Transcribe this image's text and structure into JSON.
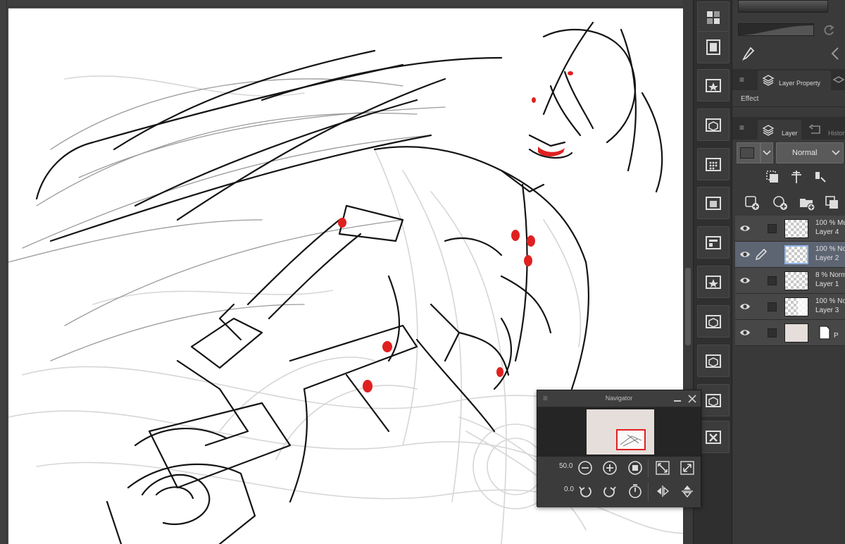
{
  "panels": {
    "layer_property_tab": "Layer Property",
    "effect_label": "Effect",
    "layer_tab": "Layer",
    "history_tab": "History",
    "blend_mode": "Normal"
  },
  "layers": [
    {
      "line1": "100 % Mu",
      "line2": "Layer 4",
      "thumb": "checker",
      "selected": false,
      "editing": false
    },
    {
      "line1": "100 % No",
      "line2": "Layer 2",
      "thumb": "checker",
      "selected": true,
      "editing": true
    },
    {
      "line1": "8 % Norm",
      "line2": "Layer 1",
      "thumb": "checker",
      "selected": false,
      "editing": false
    },
    {
      "line1": "100 % No",
      "line2": "Layer 3",
      "thumb": "checker-light",
      "selected": false,
      "editing": false
    },
    {
      "line1": "",
      "line2": "P",
      "thumb": "paper",
      "selected": false,
      "editing": false
    }
  ],
  "navigator": {
    "title": "Navigator",
    "zoom": "50.0",
    "rotation": "0.0"
  },
  "colors": {
    "accent_red": "#e02020",
    "panel_bg": "#3a3a3a",
    "selected_row": "#5d6472"
  },
  "icons": {
    "tool_strip": [
      "color-set-icon",
      "animation-icon",
      "material-star-icon",
      "material-3d-icon",
      "material-tone-icon",
      "material-pattern-icon",
      "material-layout-icon",
      "material-star-icon",
      "material-3d-icon",
      "material-3d-icon",
      "material-3d-icon",
      "material-close-icon"
    ]
  }
}
